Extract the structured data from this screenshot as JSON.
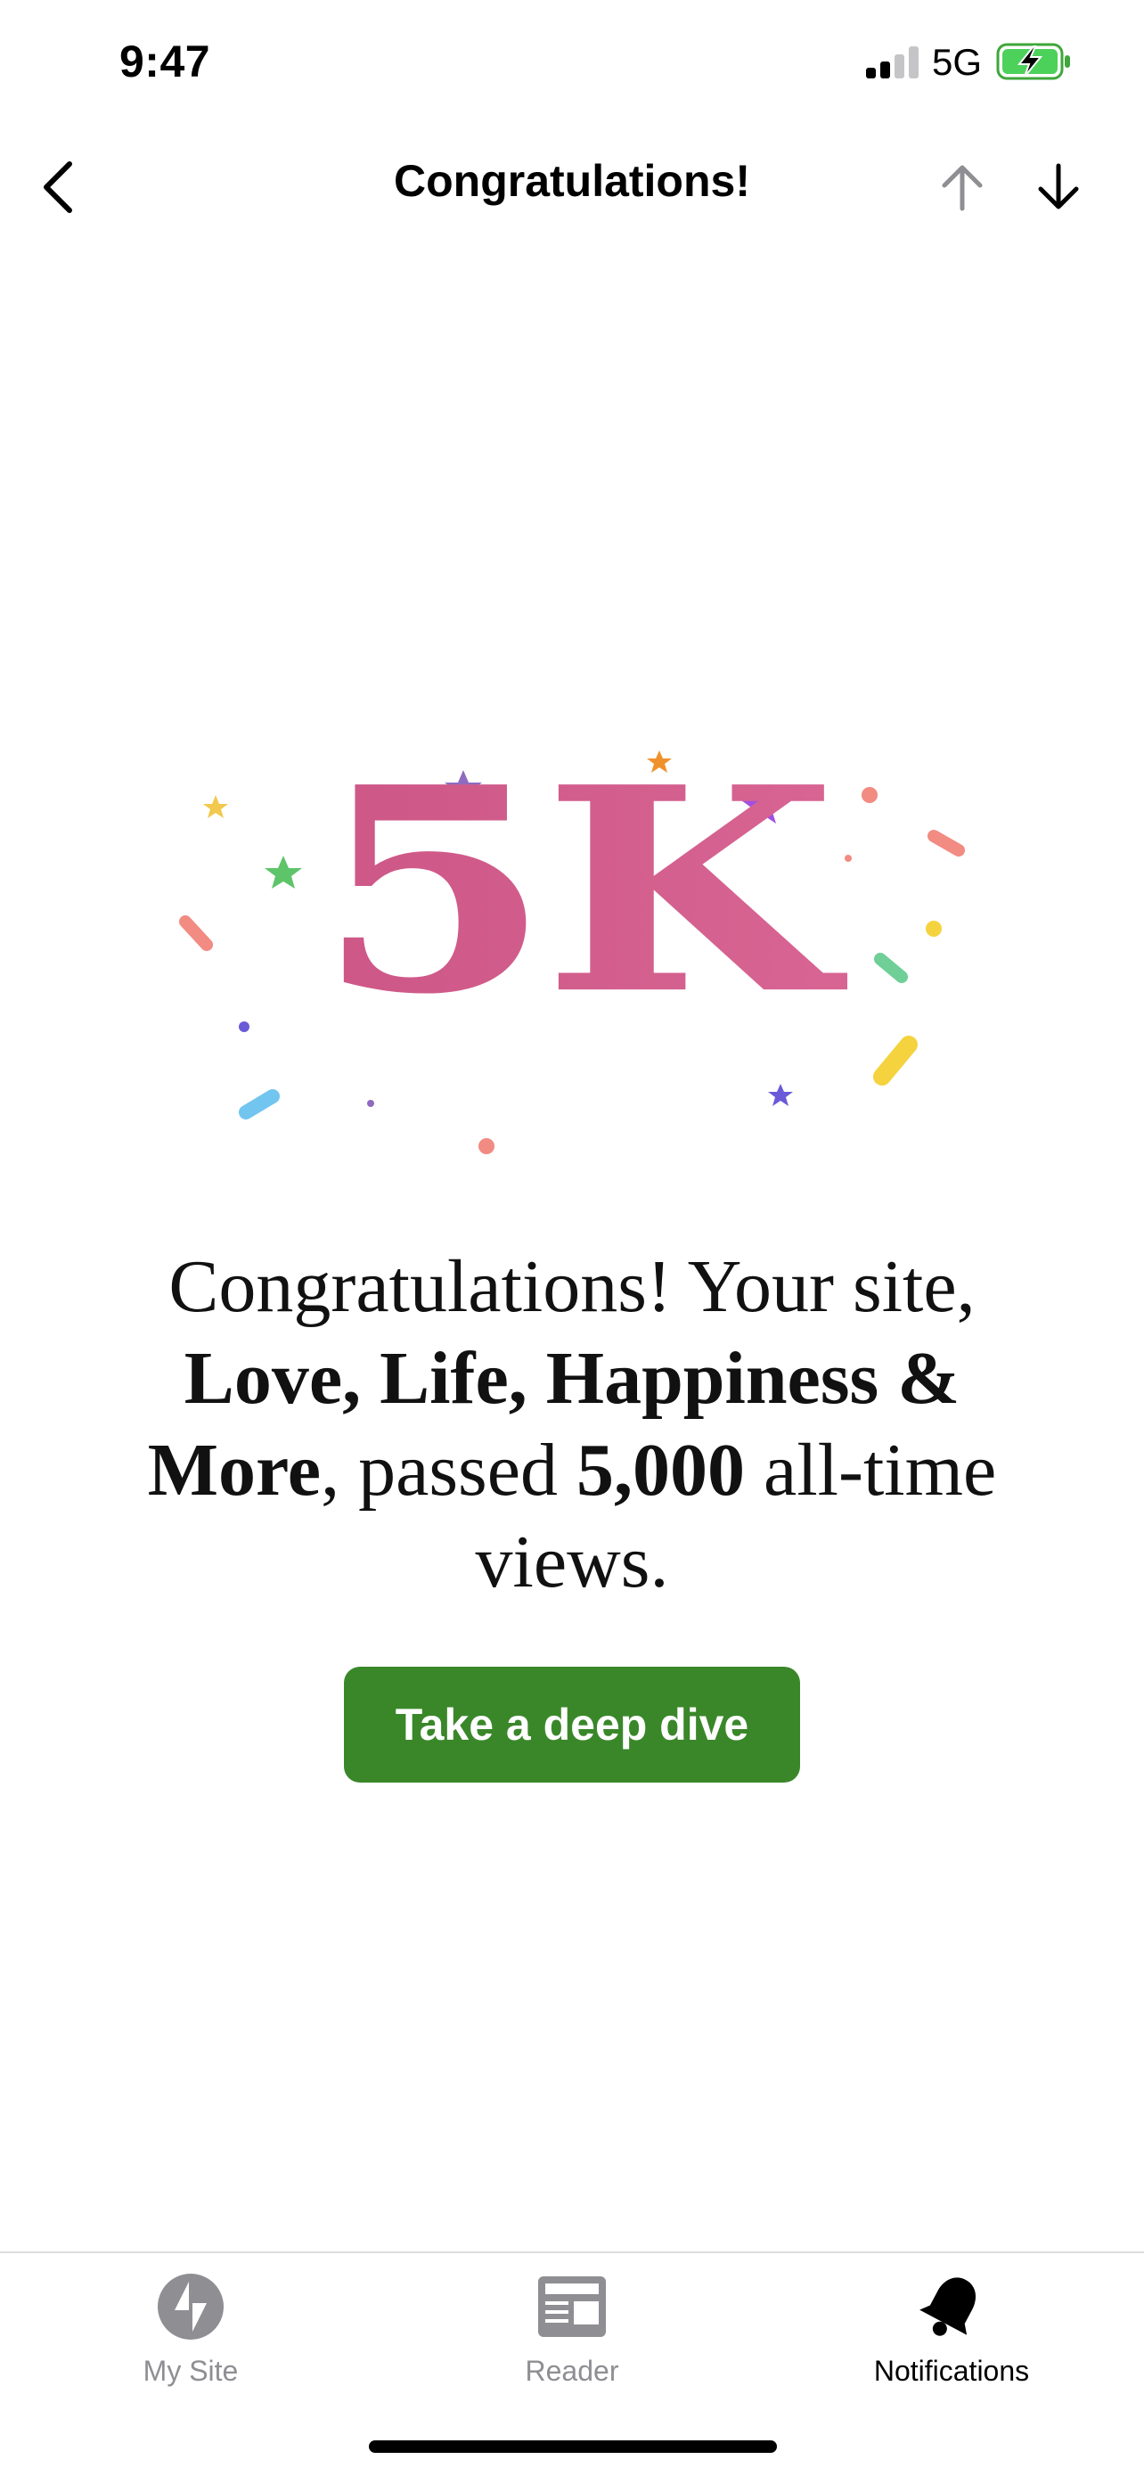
{
  "status_bar": {
    "time": "9:47",
    "network": "5G",
    "icons": [
      "signal-icon",
      "battery-charging-icon"
    ]
  },
  "nav": {
    "title": "Congratulations!",
    "icons": [
      "chevron-left-icon",
      "arrow-up-icon",
      "arrow-down-icon"
    ]
  },
  "milestone": {
    "label": "5K",
    "color": "#d45a8a"
  },
  "message": {
    "intro": "Congratulations! Your site, ",
    "site_name": "Love, Life, Happiness & More",
    "middle": ", passed ",
    "count": "5,000",
    "suffix": " all-time views."
  },
  "cta": {
    "label": "Take a deep dive",
    "color": "#3a872a"
  },
  "tabs": [
    {
      "label": "My Site",
      "icon": "jetpack-icon",
      "active": false
    },
    {
      "label": "Reader",
      "icon": "reader-icon",
      "active": false
    },
    {
      "label": "Notifications",
      "icon": "bell-icon",
      "active": true
    }
  ]
}
